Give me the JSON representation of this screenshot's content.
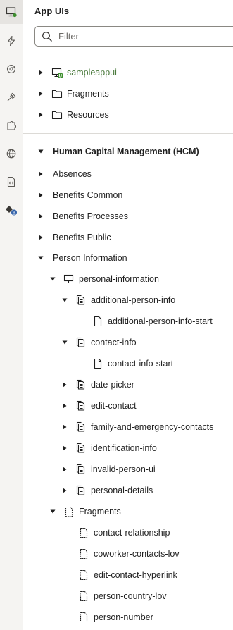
{
  "panel": {
    "title": "App UIs",
    "filter": {
      "placeholder": "Filter",
      "value": ""
    }
  },
  "rail": [
    {
      "name": "app-uis-icon",
      "active": true
    },
    {
      "name": "actions-icon",
      "active": false
    },
    {
      "name": "events-icon",
      "active": false
    },
    {
      "name": "services-icon",
      "active": false
    },
    {
      "name": "components-icon",
      "active": false
    },
    {
      "name": "web-apps-icon",
      "active": false
    },
    {
      "name": "source-files-icon",
      "active": false
    },
    {
      "name": "extensions-icon",
      "active": false
    }
  ],
  "tree": {
    "sampleappui": {
      "label": "sampleappui",
      "icon": "monitor-icon",
      "badge": "U"
    },
    "fragments_top": {
      "label": "Fragments",
      "icon": "folder-icon"
    },
    "resources": {
      "label": "Resources",
      "icon": "folder-icon"
    },
    "hcm": {
      "label": "Human Capital Management (HCM)"
    },
    "absences": {
      "label": "Absences"
    },
    "benefits_common": {
      "label": "Benefits Common"
    },
    "benefits_processes": {
      "label": "Benefits Processes"
    },
    "benefits_public": {
      "label": "Benefits Public"
    },
    "person_information": {
      "label": "Person Information"
    },
    "personal_information": {
      "label": "personal-information",
      "icon": "monitor-icon"
    },
    "additional_person_info": {
      "label": "additional-person-info",
      "icon": "flow-icon"
    },
    "additional_person_info_start": {
      "label": "additional-person-info-start",
      "icon": "page-icon"
    },
    "contact_info": {
      "label": "contact-info",
      "icon": "flow-icon"
    },
    "contact_info_start": {
      "label": "contact-info-start",
      "icon": "page-icon"
    },
    "date_picker": {
      "label": "date-picker",
      "icon": "flow-icon"
    },
    "edit_contact": {
      "label": "edit-contact",
      "icon": "flow-icon"
    },
    "family_and_emergency_contacts": {
      "label": "family-and-emergency-contacts",
      "icon": "flow-icon"
    },
    "identification_info": {
      "label": "identification-info",
      "icon": "flow-icon"
    },
    "invalid_person_ui": {
      "label": "invalid-person-ui",
      "icon": "flow-icon"
    },
    "personal_details": {
      "label": "personal-details",
      "icon": "flow-icon"
    },
    "fragments": {
      "label": "Fragments",
      "icon": "fragment-folder-icon"
    },
    "contact_relationship": {
      "label": "contact-relationship",
      "icon": "fragment-icon"
    },
    "coworker_contacts_lov": {
      "label": "coworker-contacts-lov",
      "icon": "fragment-icon"
    },
    "edit_contact_hyperlink": {
      "label": "edit-contact-hyperlink",
      "icon": "fragment-icon"
    },
    "person_country_lov": {
      "label": "person-country-lov",
      "icon": "fragment-icon"
    },
    "person_number": {
      "label": "person-number",
      "icon": "fragment-icon"
    }
  },
  "colors": {
    "accent_green": "#4a7a3c",
    "rail_bg": "#f5f4f2",
    "badge_blue": "#2f5fa8",
    "text": "#1f1f1f"
  }
}
